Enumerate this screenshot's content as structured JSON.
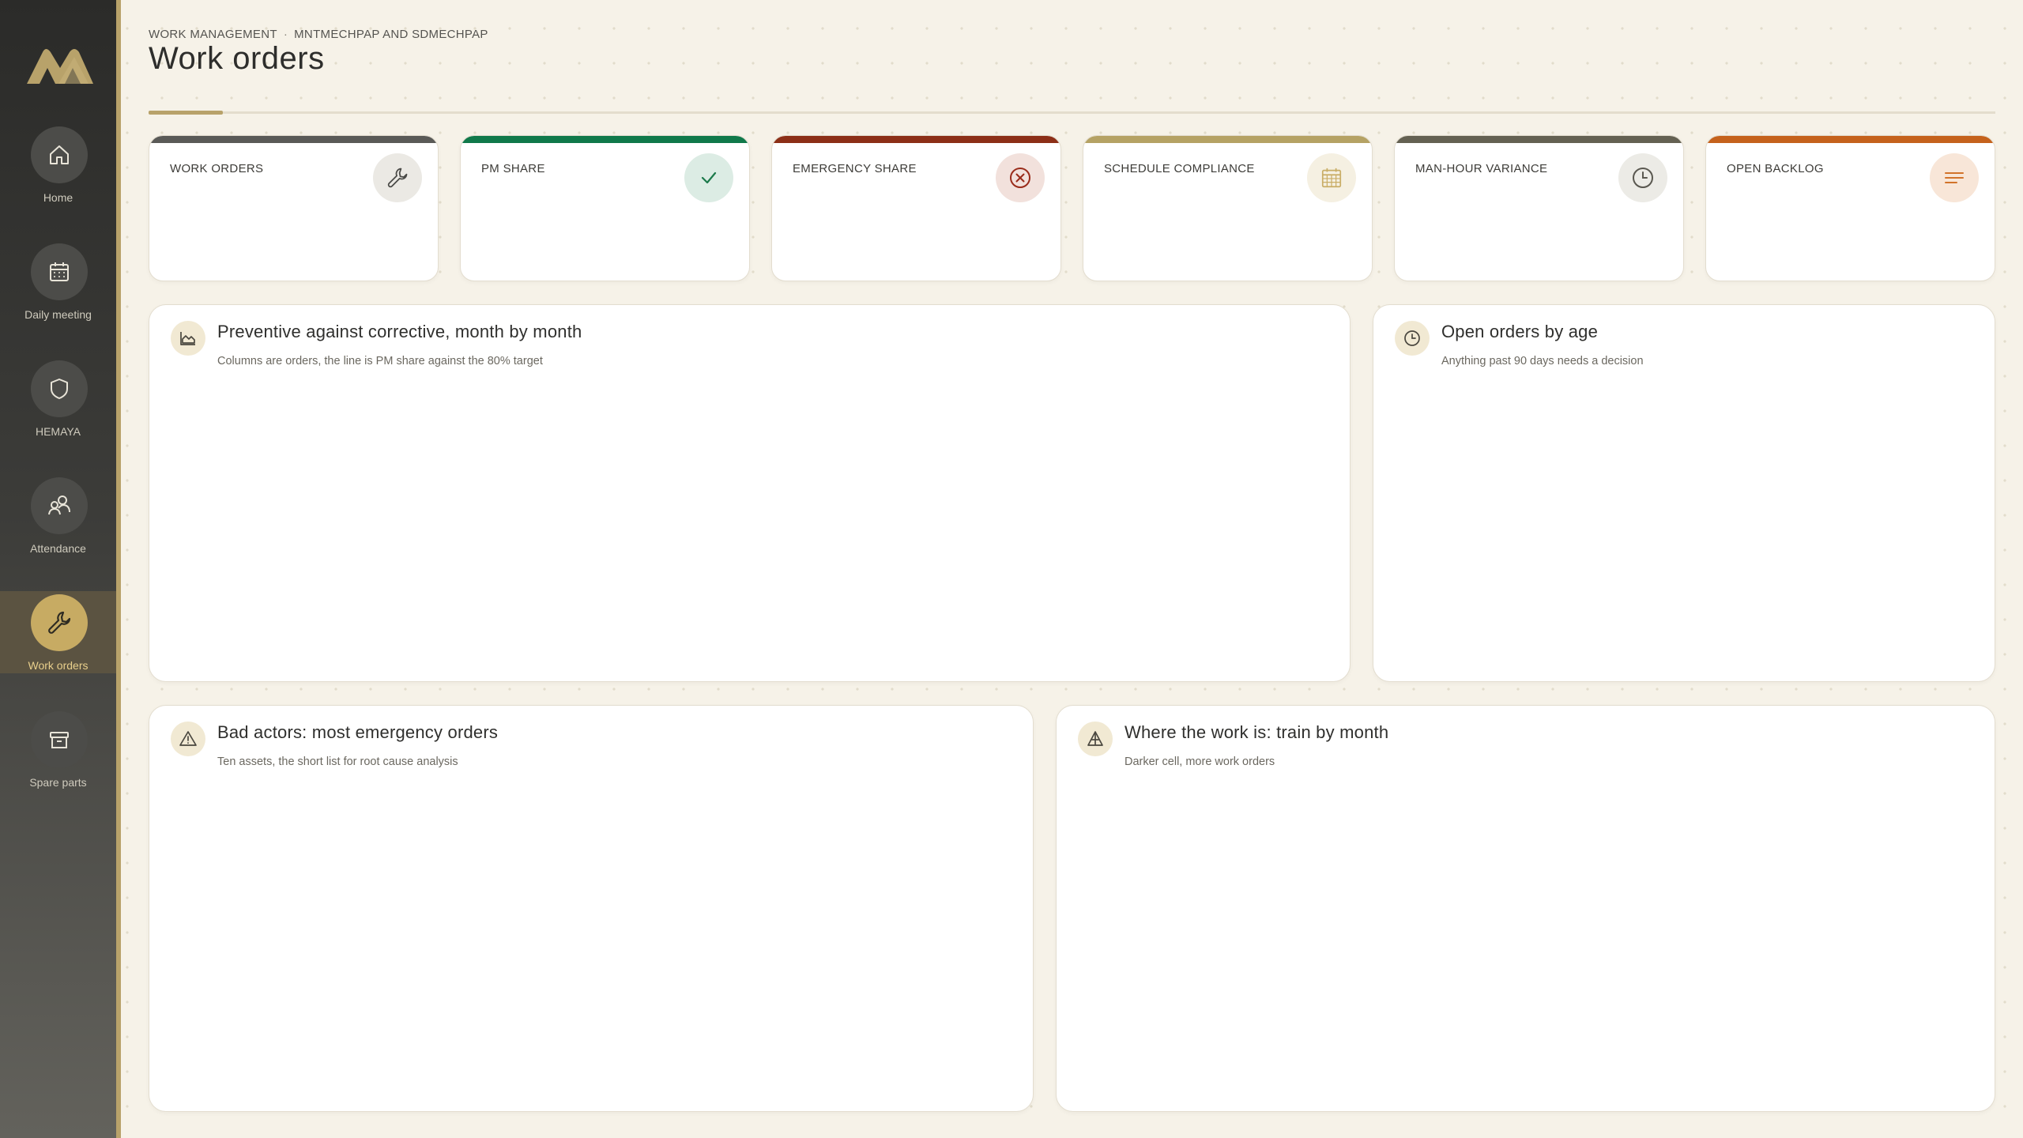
{
  "sidebar": {
    "logo": "company-logo",
    "items": [
      {
        "label": "Home",
        "icon": "home-icon",
        "active": false
      },
      {
        "label": "Daily meeting",
        "icon": "calendar-icon",
        "active": false
      },
      {
        "label": "HEMAYA",
        "icon": "shield-icon",
        "active": false
      },
      {
        "label": "Attendance",
        "icon": "people-icon",
        "active": false
      },
      {
        "label": "Work orders",
        "icon": "wrench-icon",
        "active": true
      },
      {
        "label": "Spare parts",
        "icon": "box-icon",
        "active": false
      }
    ]
  },
  "header": {
    "breadcrumb": [
      "WORK MANAGEMENT",
      "MNTMECHPAP AND SDMECHPAP"
    ],
    "breadcrumb_separator": "·",
    "title": "Work orders"
  },
  "kpis": [
    {
      "label": "WORK ORDERS",
      "icon": "wrench-icon",
      "bar_color": "#5a5a57",
      "icon_bg": "#ebe9e4",
      "icon_color": "#4a4a47"
    },
    {
      "label": "PM SHARE",
      "icon": "check-icon",
      "bar_color": "#10794a",
      "icon_bg": "#dcece4",
      "icon_color": "#1c7a4b"
    },
    {
      "label": "EMERGENCY SHARE",
      "icon": "x-circle-icon",
      "bar_color": "#8c2f17",
      "icon_bg": "#f2e1dc",
      "icon_color": "#9a2c1b"
    },
    {
      "label": "SCHEDULE COMPLIANCE",
      "icon": "calendar-icon",
      "bar_color": "#b5a264",
      "icon_bg": "#f5f0e2",
      "icon_color": "#c9ad66"
    },
    {
      "label": "MAN-HOUR VARIANCE",
      "icon": "clock-icon",
      "bar_color": "#646152",
      "icon_bg": "#ecebe6",
      "icon_color": "#5a5850"
    },
    {
      "label": "OPEN BACKLOG",
      "icon": "lines-icon",
      "bar_color": "#c5621c",
      "icon_bg": "#f8e6d8",
      "icon_color": "#d2732a"
    }
  ],
  "panels": {
    "pm_vs_corrective": {
      "title": "Preventive against corrective, month by month",
      "subtitle": "Columns are orders, the line is PM share against the 80% target",
      "icon": "area-chart-icon"
    },
    "open_orders_age": {
      "title": "Open orders by age",
      "subtitle": "Anything past 90 days needs a decision",
      "icon": "clock-icon"
    },
    "bad_actors": {
      "title": "Bad actors: most emergency orders",
      "subtitle": "Ten assets, the short list for root cause analysis",
      "icon": "warning-icon"
    },
    "where_work_is": {
      "title": "Where the work is: train by month",
      "subtitle": "Darker cell, more work orders",
      "icon": "pyramid-icon"
    }
  },
  "colors": {
    "accent": "#b8a26a",
    "sidebar_dark": "#2b2b29",
    "background": "#f6f2e8"
  }
}
